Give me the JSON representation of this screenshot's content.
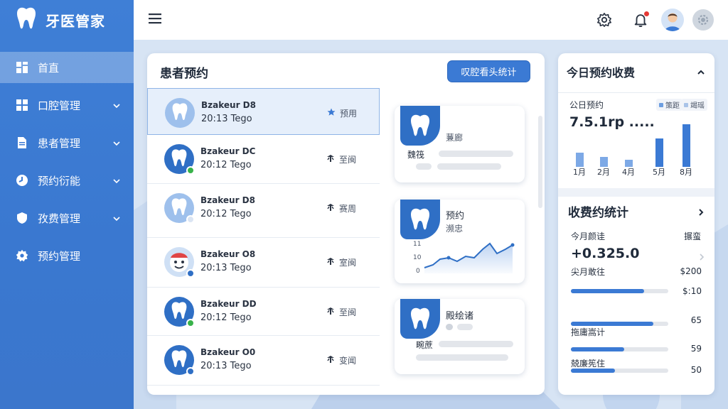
{
  "app": {
    "title": "牙医管家"
  },
  "sidebar": {
    "items": [
      {
        "label": "首直",
        "icon": "grid-icon",
        "active": true,
        "has_chevron": false
      },
      {
        "label": "口腔管理",
        "icon": "apps-icon",
        "active": false,
        "has_chevron": true
      },
      {
        "label": "患者管理",
        "icon": "document-icon",
        "active": false,
        "has_chevron": true
      },
      {
        "label": "预约衍能",
        "icon": "clock-icon",
        "active": false,
        "has_chevron": true
      },
      {
        "label": "孜费管理",
        "icon": "shield-icon",
        "active": false,
        "has_chevron": true
      },
      {
        "label": "预约管理",
        "icon": "gear-icon",
        "active": false,
        "has_chevron": false
      }
    ]
  },
  "topbar": {
    "icons": [
      "menu-icon",
      "gear-icon",
      "bell-icon",
      "avatar",
      "settings-icon"
    ]
  },
  "patients": {
    "title": "患者预约",
    "button": "叹腔看头统计",
    "rows": [
      {
        "name": "Bzakeur D8",
        "time": "20:13 Tego",
        "status": "预用",
        "status_icon": "star-icon",
        "avatar": "tooth-light",
        "badge": "",
        "selected": true
      },
      {
        "name": "Bzakeur DC",
        "time": "20:12 Tego",
        "status": "至闽",
        "status_icon": "pin-icon",
        "avatar": "tooth-dark",
        "badge": "#38b24a",
        "selected": false
      },
      {
        "name": "Bzakeur D8",
        "time": "20:12 Tego",
        "status": "赛周",
        "status_icon": "pin-icon",
        "avatar": "tooth-light",
        "badge": "#dbe5f3",
        "selected": false
      },
      {
        "name": "Bzakeur O8",
        "time": "20:13 Tego",
        "status": "室闽",
        "status_icon": "pin-icon",
        "avatar": "face",
        "badge": "#2f6fc5",
        "selected": false
      },
      {
        "name": "Bzakeur DD",
        "time": "20:12 Tego",
        "status": "至闽",
        "status_icon": "pin-icon",
        "avatar": "tooth-dark",
        "badge": "#38b24a",
        "selected": false
      },
      {
        "name": "Bzakeur O0",
        "time": "20:13 Tego",
        "status": "变闻",
        "status_icon": "pin-icon",
        "avatar": "tooth-dark",
        "badge": "#2f6fc5",
        "selected": false
      }
    ],
    "cards": [
      {
        "title": "蒹廊",
        "subtitle": "魏筏"
      },
      {
        "title": "预约",
        "subtitle": "濒忠",
        "chart": {
          "y_labels": [
            "11",
            "10",
            "0"
          ]
        }
      },
      {
        "title": "殿绘诸",
        "subtitle": "畹蔗"
      }
    ]
  },
  "fees": {
    "title": "今日预约收费",
    "today_label": "公日预约",
    "legend": [
      "策距",
      "竭瑶"
    ],
    "today_value": "7.5.1rp .....",
    "bar_chart": {
      "categories": [
        "1月",
        "2月",
        "4月",
        "5月",
        "8月"
      ],
      "series": [
        {
          "values": [
            20,
            14,
            10,
            0,
            0
          ]
        },
        {
          "values": [
            0,
            0,
            0,
            40,
            60
          ]
        }
      ]
    },
    "stats_title": "收费约统计",
    "month_label": "今月颜诖",
    "month_right": "搌蛮",
    "month_value": "+0.325.0",
    "rows": [
      {
        "label": "尖月敢往",
        "value": "$200",
        "fill": 0.75
      },
      {
        "label": "",
        "value": "$:10",
        "fill": 0.0
      },
      {
        "label": "拖庸嵩计",
        "value": "65",
        "fill": 0.85
      },
      {
        "label": "兢廉筅住",
        "value": "59",
        "fill": 0.55
      },
      {
        "label": "",
        "value": "50",
        "fill": 0.45
      }
    ]
  }
}
